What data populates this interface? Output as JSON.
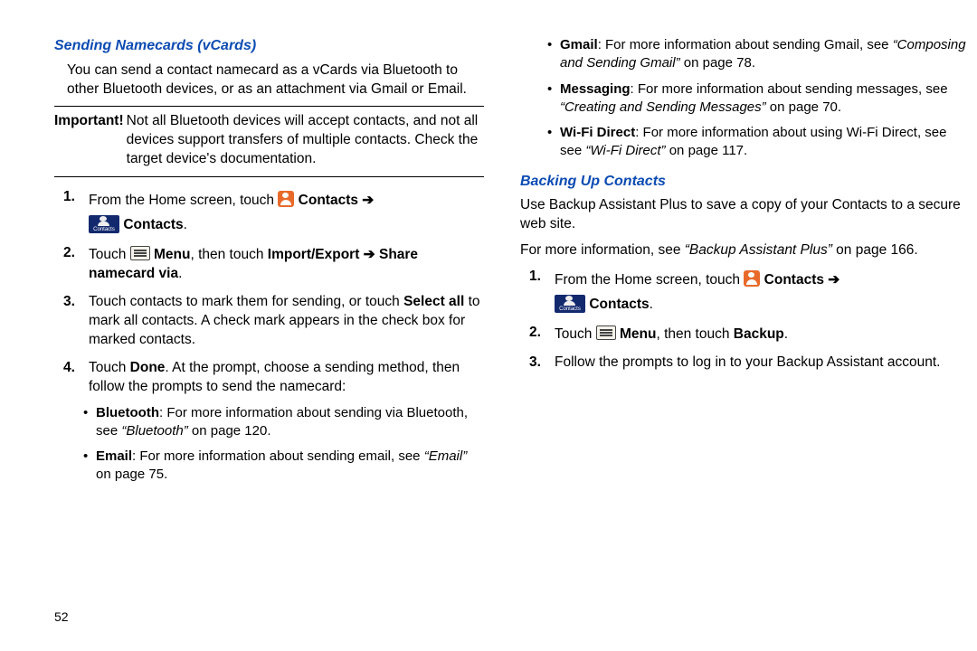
{
  "page_number": "52",
  "left": {
    "heading1": "Sending Namecards (vCards)",
    "intro": "You can send a contact namecard as a vCards via Bluetooth to other Bluetooth devices, or as an attachment via Gmail or Email.",
    "important_label": "Important!",
    "important_text": "Not all Bluetooth devices will accept contacts, and not all devices support transfers of multiple contacts. Check the target device's documentation.",
    "step1_a": "From the Home screen, touch ",
    "step1_b": "Contacts",
    "step1_c": " ➔ ",
    "step1_d": "Contacts",
    "step1_e": ".",
    "step2_a": "Touch ",
    "step2_b": "Menu",
    "step2_c": ", then touch ",
    "step2_d": "Import/Export ➔ Share namecard via",
    "step2_e": ".",
    "step3_a": "Touch contacts to mark them for sending, or touch ",
    "step3_b": "Select all",
    "step3_c": " to mark all contacts. A check mark appears in the check box for marked contacts.",
    "step4_a": "Touch ",
    "step4_b": "Done",
    "step4_c": ". At the prompt, choose a sending method, then follow the prompts to send the namecard:",
    "bullet_bt_a": "Bluetooth",
    "bullet_bt_b": ": For more information about sending via Bluetooth, see ",
    "bullet_bt_ref": "“Bluetooth”",
    "bullet_bt_c": " on page 120.",
    "bullet_em_a": "Email",
    "bullet_em_b": ": For more information about sending email, see ",
    "bullet_em_ref": "“Email”",
    "bullet_em_c": " on page 75."
  },
  "right": {
    "bullet_gm_a": "Gmail",
    "bullet_gm_b": ": For more information about sending Gmail, see ",
    "bullet_gm_ref": "“Composing and Sending Gmail”",
    "bullet_gm_c": " on page 78.",
    "bullet_ms_a": "Messaging",
    "bullet_ms_b": ": For more information about sending messages, see ",
    "bullet_ms_ref": "“Creating and Sending Messages”",
    "bullet_ms_c": " on page 70.",
    "bullet_wf_a": "Wi-Fi Direct",
    "bullet_wf_b": ": For more information about using Wi-Fi Direct, see see ",
    "bullet_wf_ref": "“Wi-Fi Direct”",
    "bullet_wf_c": " on page 117.",
    "heading2": "Backing Up Contacts",
    "intro1": "Use Backup Assistant Plus to save a copy of your Contacts to a secure web site.",
    "intro2_a": "For more information, see ",
    "intro2_ref": "“Backup Assistant Plus”",
    "intro2_b": " on page 166.",
    "step1_a": "From the Home screen, touch ",
    "step1_b": "Contacts",
    "step1_c": " ➔ ",
    "step1_d": "Contacts",
    "step1_e": ".",
    "step2_a": "Touch ",
    "step2_b": "Menu",
    "step2_c": ", then touch ",
    "step2_d": "Backup",
    "step2_e": ".",
    "step3": "Follow the prompts to log in to your Backup Assistant account."
  },
  "icon_folder_text": "Contacts"
}
